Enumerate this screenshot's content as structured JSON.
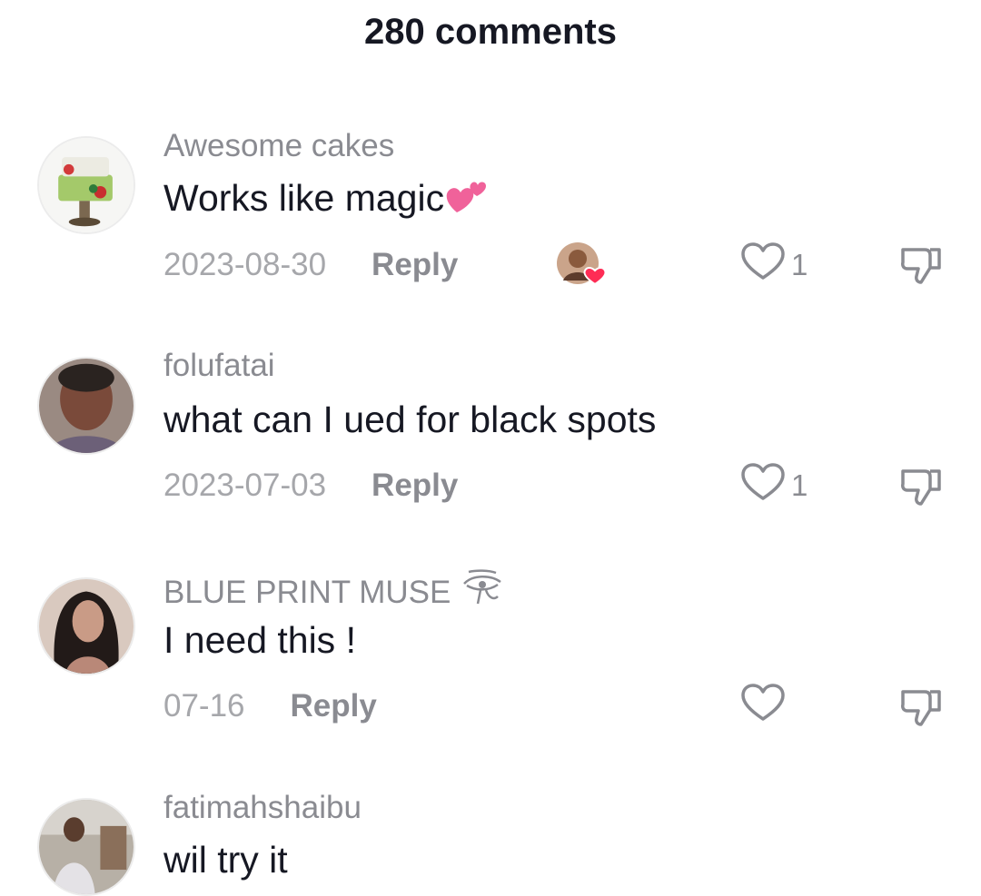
{
  "header": {
    "title": "280 comments"
  },
  "comments": [
    {
      "username": "Awesome cakes",
      "text": "Works like magic",
      "emoji": "two-hearts-emoji",
      "date": "2023-08-30",
      "reply_label": "Reply",
      "likes": "1",
      "liked_by_creator": true,
      "avatar": "cake-avatar"
    },
    {
      "username": "folufatai",
      "text": "what can I ued for black spots",
      "date": "2023-07-03",
      "reply_label": "Reply",
      "likes": "1",
      "avatar": "person-avatar"
    },
    {
      "username": "BLUE PRINT MUSE",
      "badge_icon": "eye-of-horus-icon",
      "text": "I need this !",
      "date": "07-16",
      "reply_label": "Reply",
      "likes": "",
      "avatar": "person-avatar"
    },
    {
      "username": "fatimahshaibu",
      "text": "wil try it",
      "avatar": "person-avatar"
    }
  ],
  "colors": {
    "username": "#8a8b91",
    "date": "#a6a7ab",
    "text": "#161823",
    "heart_accent": "#fe2c55"
  }
}
